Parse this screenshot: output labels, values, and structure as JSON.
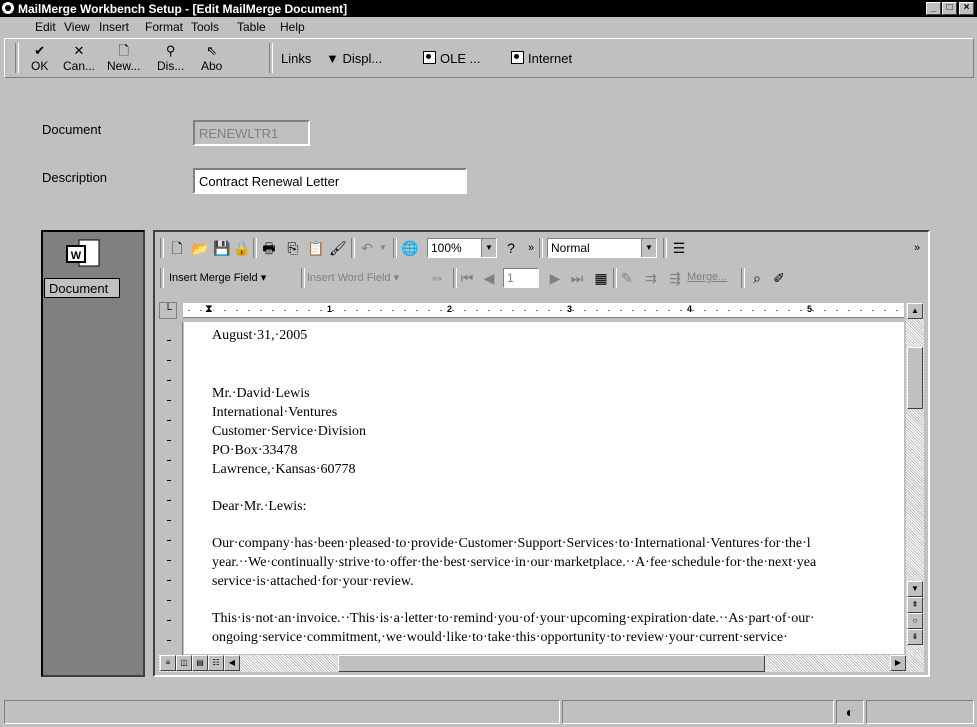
{
  "window": {
    "title": "MailMerge Workbench Setup - [Edit MailMerge Document]",
    "buttons": [
      "_",
      "□",
      "×"
    ]
  },
  "menu": [
    "Edit",
    "View",
    "Insert",
    "Format",
    "Tools",
    "Table",
    "Help"
  ],
  "toolbar": {
    "ok": "OK",
    "cancel": "Can...",
    "new": "New...",
    "display": "Dis...",
    "about": "Abo",
    "links": "Links",
    "displ": "Displ...",
    "ole": "OLE ...",
    "internet": "Internet"
  },
  "form": {
    "document_label": "Document",
    "document_value": "RENEWLTR1",
    "description_label": "Description",
    "description_value": "Contract Renewal Letter"
  },
  "nav": {
    "document_label": "Document"
  },
  "word_toolbar": {
    "zoom": "100%",
    "style": "Normal",
    "insert_merge_field": "Insert Merge Field",
    "insert_word_field": "Insert Word Field",
    "record": "1",
    "merge": "Merge..."
  },
  "ruler": {
    "marks": [
      "1",
      "2",
      "3",
      "4",
      "5"
    ]
  },
  "letter": {
    "date": "August·31,·2005",
    "addr1": "Mr.·David·Lewis",
    "addr2": "International·Ventures",
    "addr3": "Customer·Service·Division",
    "addr4": "PO·Box·33478",
    "addr5": "Lawrence,·Kansas·60778",
    "salutation": "Dear·Mr.·Lewis:",
    "p1_l1": "Our·company·has·been·pleased·to·provide·Customer·Support·Services·to·International·Ventures·for·the·l",
    "p1_l2": "year.··We·continually·strive·to·offer·the·best·service·in·our·marketplace.··A·fee·schedule·for·the·next·yea",
    "p1_l3": "service·is·attached·for·your·review.",
    "p2_l1": "This·is·not·an·invoice.··This·is·a·letter·to·remind·you·of·your·upcoming·expiration·date.··As·part·of·our·",
    "p2_l2": "ongoing·service·commitment,·we·would·like·to·take·this·opportunity·to·review·your·current·service·"
  }
}
